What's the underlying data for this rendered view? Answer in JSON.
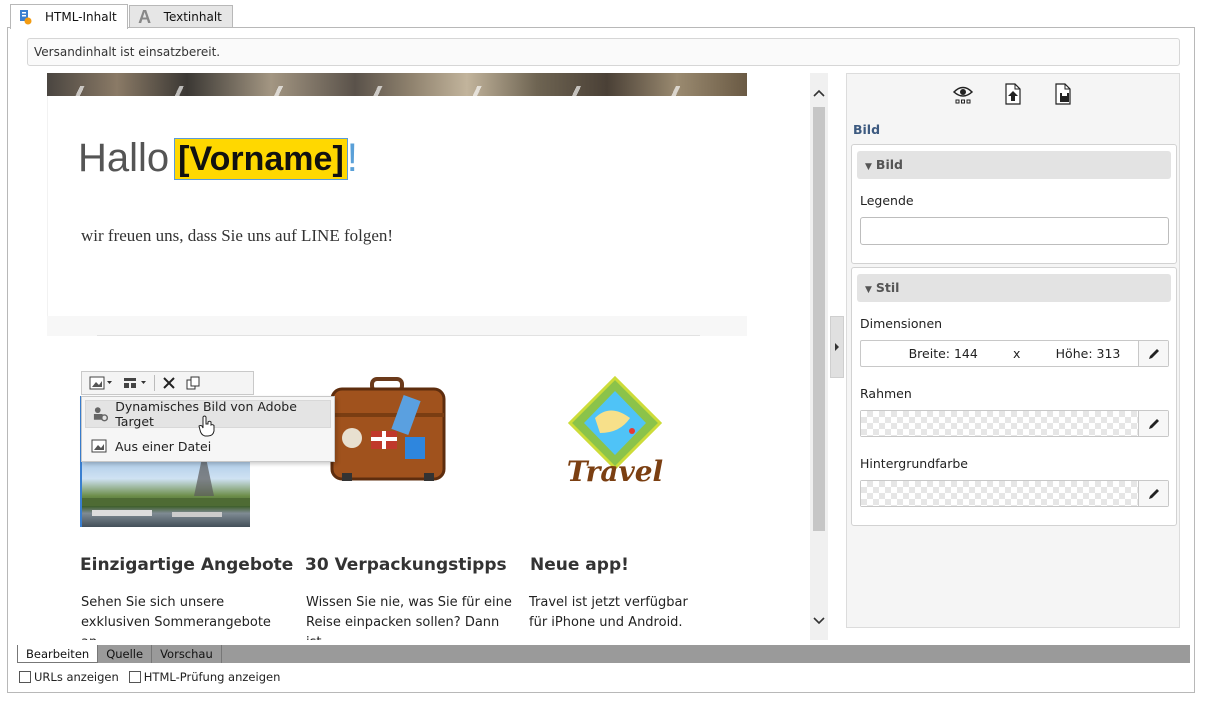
{
  "tabs": [
    {
      "label": "HTML-Inhalt",
      "icon": "html-content-icon",
      "active": true
    },
    {
      "label": "Textinhalt",
      "icon": "text-content-icon",
      "active": false
    }
  ],
  "status_message": "Versandinhalt ist einsatzbereit.",
  "email": {
    "greeting": "Hallo",
    "personalization": "[Vorname]",
    "greeting_punct": "!",
    "intro": "wir freuen uns, dass Sie uns auf LINE folgen!",
    "travel_logo_text": "Travel",
    "columns": [
      {
        "title": "Einzigartige Angebote",
        "text": "Sehen Sie sich unsere exklusiven Sommerangebote an."
      },
      {
        "title": "30 Verpackungstipps",
        "text": "Wissen Sie nie, was Sie für eine Reise einpacken sollen? Dann ist"
      },
      {
        "title": "Neue app!",
        "text": "Travel ist jetzt verfügbar für iPhone und Android."
      }
    ]
  },
  "image_menu": {
    "items": [
      {
        "label": "Dynamisches Bild von Adobe Target",
        "icon": "target-image-icon"
      },
      {
        "label": "Aus einer Datei",
        "icon": "image-file-icon"
      }
    ]
  },
  "panel": {
    "heading": "Bild",
    "groups": {
      "bild": {
        "title": "Bild",
        "legend_label": "Legende",
        "legend_value": ""
      },
      "stil": {
        "title": "Stil",
        "dimensions_label": "Dimensionen",
        "width_text": "Breite: 144",
        "times": "x",
        "height_text": "Höhe: 313",
        "border_label": "Rahmen",
        "background_label": "Hintergrundfarbe"
      }
    }
  },
  "bottom_tabs": [
    {
      "label": "Bearbeiten",
      "active": true
    },
    {
      "label": "Quelle",
      "active": false
    },
    {
      "label": "Vorschau",
      "active": false
    }
  ],
  "options": [
    {
      "label": "URLs anzeigen",
      "checked": false
    },
    {
      "label": "HTML-Prüfung anzeigen",
      "checked": false
    }
  ]
}
